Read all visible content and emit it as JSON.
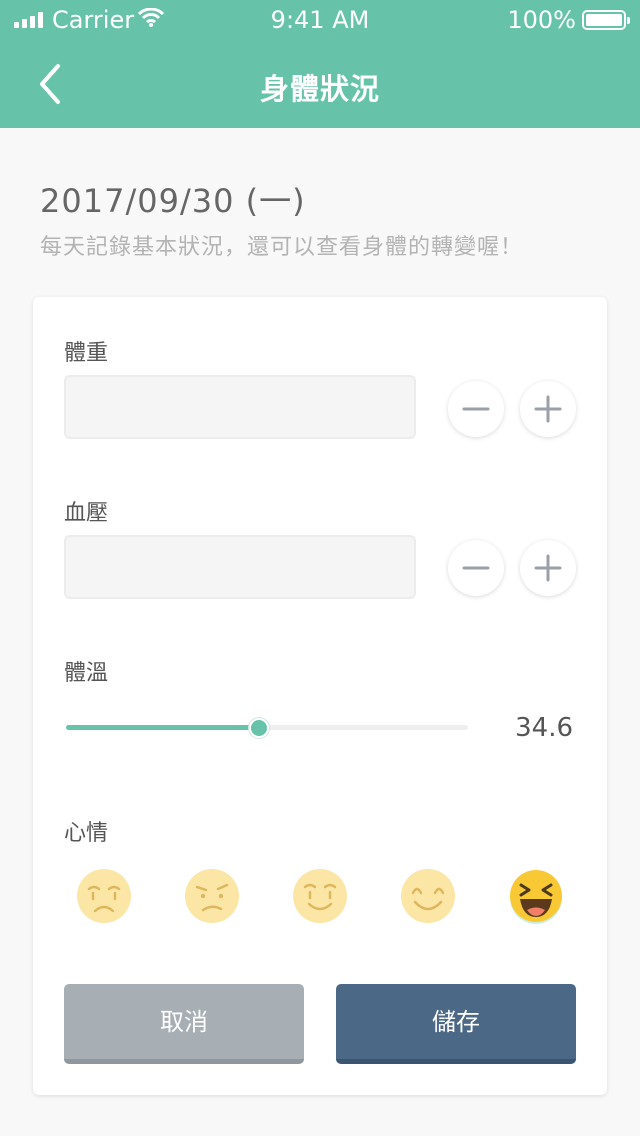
{
  "status_bar": {
    "carrier": "Carrier",
    "time": "9:41 AM",
    "battery": "100%"
  },
  "nav": {
    "title": "身體狀況",
    "back_icon": "chevron-left-icon"
  },
  "header_info": {
    "date": "2017/09/30 (一)",
    "subtitle": "每天記錄基本狀況，還可以查看身體的轉變喔！"
  },
  "form": {
    "weight": {
      "label": "體重",
      "value": ""
    },
    "blood_pressure": {
      "label": "血壓",
      "value": ""
    },
    "temperature": {
      "label": "體溫",
      "value": "34.6",
      "slider_fraction": 0.48
    },
    "mood": {
      "label": "心情",
      "options": [
        "very-sad",
        "sad",
        "neutral-smile",
        "happy",
        "laughing"
      ],
      "selected_index": 4
    }
  },
  "actions": {
    "cancel_label": "取消",
    "save_label": "儲存"
  },
  "colors": {
    "accent": "#66c3aa",
    "save_button": "#4c6887",
    "cancel_button": "#a7afb4"
  }
}
